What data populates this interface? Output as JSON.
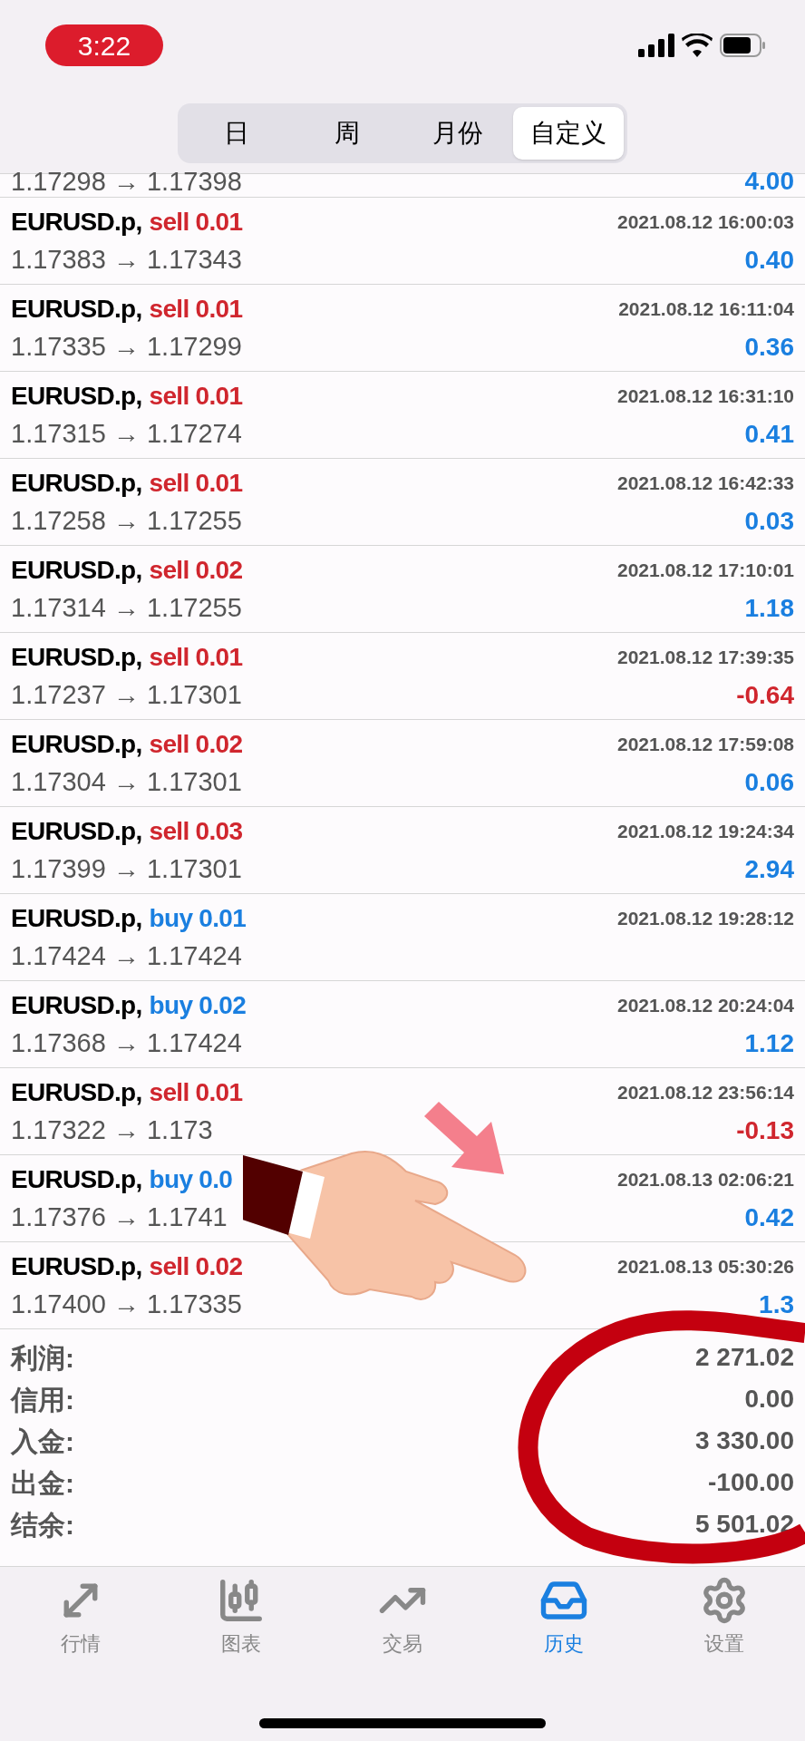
{
  "status_bar": {
    "time": "3:22"
  },
  "period_tabs": [
    {
      "label": "日",
      "selected": false
    },
    {
      "label": "周",
      "selected": false
    },
    {
      "label": "月份",
      "selected": false
    },
    {
      "label": "自定义",
      "selected": true
    }
  ],
  "partial_row": {
    "prices": "1.17298 → 1.17398",
    "profit": "4.00",
    "color": "#1a7fe0"
  },
  "trades": [
    {
      "symbol": "EURUSD.p,",
      "side": "sell 0.01",
      "kind": "sell",
      "time": "2021.08.12 16:00:03",
      "prices": "1.17383 → 1.17343",
      "profit": "0.40",
      "color": "#1a7fe0"
    },
    {
      "symbol": "EURUSD.p,",
      "side": "sell 0.01",
      "kind": "sell",
      "time": "2021.08.12 16:11:04",
      "prices": "1.17335 → 1.17299",
      "profit": "0.36",
      "color": "#1a7fe0"
    },
    {
      "symbol": "EURUSD.p,",
      "side": "sell 0.01",
      "kind": "sell",
      "time": "2021.08.12 16:31:10",
      "prices": "1.17315 → 1.17274",
      "profit": "0.41",
      "color": "#1a7fe0"
    },
    {
      "symbol": "EURUSD.p,",
      "side": "sell 0.01",
      "kind": "sell",
      "time": "2021.08.12 16:42:33",
      "prices": "1.17258 → 1.17255",
      "profit": "0.03",
      "color": "#1a7fe0"
    },
    {
      "symbol": "EURUSD.p,",
      "side": "sell 0.02",
      "kind": "sell",
      "time": "2021.08.12 17:10:01",
      "prices": "1.17314 → 1.17255",
      "profit": "1.18",
      "color": "#1a7fe0"
    },
    {
      "symbol": "EURUSD.p,",
      "side": "sell 0.01",
      "kind": "sell",
      "time": "2021.08.12 17:39:35",
      "prices": "1.17237 → 1.17301",
      "profit": "-0.64",
      "color": "#d0262e"
    },
    {
      "symbol": "EURUSD.p,",
      "side": "sell 0.02",
      "kind": "sell",
      "time": "2021.08.12 17:59:08",
      "prices": "1.17304 → 1.17301",
      "profit": "0.06",
      "color": "#1a7fe0"
    },
    {
      "symbol": "EURUSD.p,",
      "side": "sell 0.03",
      "kind": "sell",
      "time": "2021.08.12 19:24:34",
      "prices": "1.17399 → 1.17301",
      "profit": "2.94",
      "color": "#1a7fe0"
    },
    {
      "symbol": "EURUSD.p,",
      "side": "buy 0.01",
      "kind": "buy",
      "time": "2021.08.12 19:28:12",
      "prices": "1.17424 → 1.17424"
    },
    {
      "symbol": "EURUSD.p,",
      "side": "buy 0.02",
      "kind": "buy",
      "time": "2021.08.12 20:24:04",
      "prices": "1.17368 → 1.17424",
      "profit": "1.12",
      "color": "#1a7fe0"
    },
    {
      "symbol": "EURUSD.p,",
      "side": "sell 0.01",
      "kind": "sell",
      "time": "2021.08.12 23:56:14",
      "prices": "1.17322 → 1.173",
      "profit": "-0.13",
      "color": "#d0262e"
    },
    {
      "symbol": "EURUSD.p,",
      "side": "buy 0.0",
      "kind": "buy",
      "time": "2021.08.13 02:06:21",
      "prices": "1.17376 → 1.1741",
      "profit": "0.42",
      "color": "#1a7fe0"
    },
    {
      "symbol": "EURUSD.p,",
      "side": "sell 0.02",
      "kind": "sell",
      "time": "2021.08.13 05:30:26",
      "prices": "1.17400 → 1.17335",
      "profit": "1.3",
      "color": "#1a7fe0"
    }
  ],
  "summary": [
    {
      "label": "利润:",
      "value": "2 271.02"
    },
    {
      "label": "信用:",
      "value": "0.00"
    },
    {
      "label": "入金:",
      "value": "3 330.00"
    },
    {
      "label": "出金:",
      "value": "-100.00"
    },
    {
      "label": "结余:",
      "value": "5 501.02"
    }
  ],
  "bottom_tabs": [
    {
      "label": "行情",
      "selected": false
    },
    {
      "label": "图表",
      "selected": false
    },
    {
      "label": "交易",
      "selected": false
    },
    {
      "label": "历史",
      "selected": true
    },
    {
      "label": "设置",
      "selected": false
    }
  ]
}
